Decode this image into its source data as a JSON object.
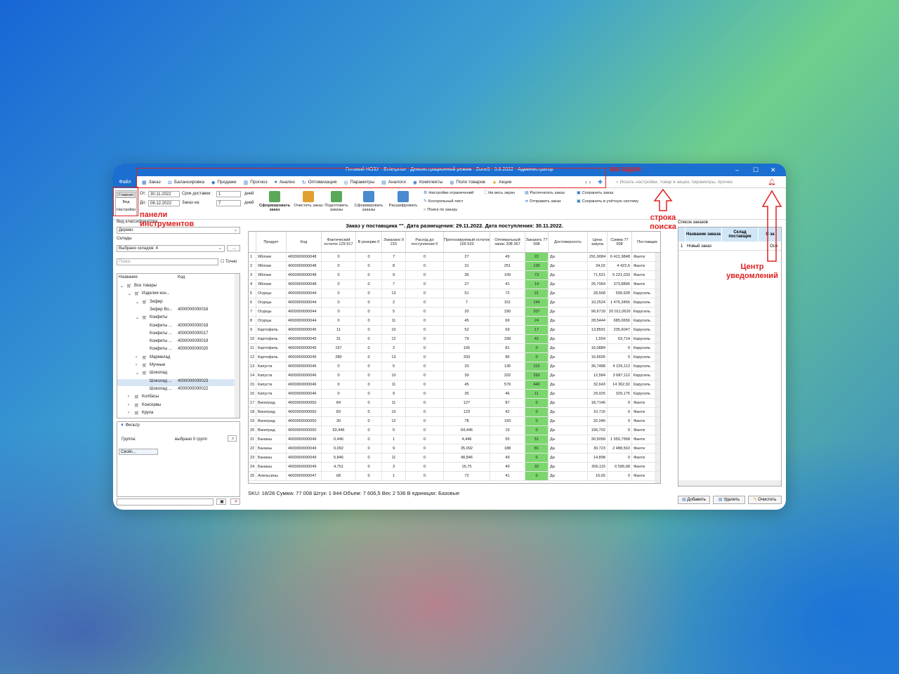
{
  "window": {
    "title": "Готовый НОЗУ · Enterprise · Демонстрационный режим · Zone5 · 5.8.2022 · Администратор",
    "min": "–",
    "max": "☐",
    "close": "✕"
  },
  "file_tab": "Файл",
  "tabs": [
    {
      "label": "Заказ",
      "icon": "order-icon"
    },
    {
      "label": "Балансировка",
      "icon": "balance-icon"
    },
    {
      "label": "Продажи",
      "icon": "sales-icon"
    },
    {
      "label": "Прогноз",
      "icon": "forecast-icon"
    },
    {
      "label": "Анализ",
      "icon": "analysis-icon"
    },
    {
      "label": "Оптимизация",
      "icon": "optimize-icon"
    },
    {
      "label": "Параметры",
      "icon": "params-icon"
    },
    {
      "label": "Аналоги",
      "icon": "analogs-icon"
    },
    {
      "label": "Комплекты",
      "icon": "kits-icon"
    },
    {
      "label": "Поля товаров",
      "icon": "fields-icon"
    },
    {
      "label": "Акции",
      "icon": "star-icon"
    }
  ],
  "search": {
    "placeholder": "Искать настройки, товар в акции, параметры, прочее"
  },
  "view_switch": [
    "Главная",
    "Вид",
    "Настройки"
  ],
  "ribbon": {
    "from_label": "От:",
    "from_value": "30.11.2022",
    "to_label": "До:",
    "to_value": "06.12.2022",
    "delivery_label": "Срок доставки:",
    "delivery_value": "1",
    "order_for_label": "Заказ на:",
    "order_for_value": "7",
    "days1": "дней",
    "days2": "дней",
    "big_buttons": [
      "Сформировать заказ",
      "Очистить заказ",
      "Подготовить заказы",
      "Сформировать заказы",
      "Расшифровать"
    ],
    "small_col1": [
      "Настройки ограничений",
      "Контрольный лист",
      "Поиск по заказу"
    ],
    "fullscreen": "На весь экран",
    "small_col2": [
      "Распечатать заказ",
      "Отправить заказ"
    ],
    "small_col3": [
      "Сохранить заказ",
      "Сохранить в учётную систему"
    ]
  },
  "left": {
    "classifier_label": "Вид классификатора",
    "classifier_value": "Дерево",
    "warehouses_label": "Склады",
    "warehouses_value": "Выбрано складов: 4",
    "dots": "...",
    "search_placeholder": "Поиск",
    "exact_label": "Точно",
    "col_name": "Название",
    "col_code": "Код",
    "tree": [
      {
        "n": "Все товары",
        "c": "",
        "l": 0,
        "e": "⌄"
      },
      {
        "n": "Изделия кон...",
        "c": "",
        "l": 1,
        "e": "⌄"
      },
      {
        "n": "Зефир",
        "c": "",
        "l": 2,
        "e": "⌄"
      },
      {
        "n": "Зефир Во...",
        "c": "4000000000016",
        "l": 3,
        "e": ""
      },
      {
        "n": "Конфеты",
        "c": "",
        "l": 2,
        "e": "⌄"
      },
      {
        "n": "Конфеты ...",
        "c": "4000000000018",
        "l": 3,
        "e": ""
      },
      {
        "n": "Конфеты ...",
        "c": "4000000000017",
        "l": 3,
        "e": ""
      },
      {
        "n": "Конфеты ...",
        "c": "4000000000019",
        "l": 3,
        "e": ""
      },
      {
        "n": "Конфеты ...",
        "c": "4000000000020",
        "l": 3,
        "e": ""
      },
      {
        "n": "Мармелад",
        "c": "",
        "l": 2,
        "e": "›"
      },
      {
        "n": "Мучные",
        "c": "",
        "l": 2,
        "e": "›"
      },
      {
        "n": "Шоколад",
        "c": "",
        "l": 2,
        "e": "⌄"
      },
      {
        "n": "Шоколад ...",
        "c": "4000000000023",
        "l": 3,
        "e": ""
      },
      {
        "n": "Шоколад ...",
        "c": "4000000000022",
        "l": 3,
        "e": ""
      },
      {
        "n": "Колбасы",
        "c": "",
        "l": 1,
        "e": "›"
      },
      {
        "n": "Консервы",
        "c": "",
        "l": 1,
        "e": "›"
      },
      {
        "n": "Крупа",
        "c": "",
        "l": 1,
        "e": "›"
      }
    ],
    "filter_label": "Фильтр",
    "group_label": "Группа:",
    "group_value": "выбрано 0 групп",
    "props": "Свойс..."
  },
  "order": {
    "title": "Заказ у поставщика \"\". Дата размещения: 29.11.2022. Дата поступления: 30.11.2022.",
    "headers": [
      "",
      "Продукт",
      "Код",
      "Фактический остаток 129 917",
      "В резерве 0",
      "Заказано 9 215",
      "Расход до поступления 0",
      "Прогнозируемый остаток 166 533",
      "Оптимальный запас 208 367",
      "Заказать 77 008",
      "Достоверность",
      "Цена закупа",
      "Сумма 77 008",
      "Поставщик"
    ],
    "rows": [
      [
        "1",
        "Яблоки",
        "4000000000048",
        "0",
        "0",
        "7",
        "0",
        "27",
        "49",
        "22",
        "Да",
        "291,9084",
        "6 421,9848",
        "Фанти"
      ],
      [
        "2",
        "Яблоки",
        "4000000000048",
        "0",
        "0",
        "8",
        "0",
        "31",
        "251",
        "130",
        "Да",
        "34,02",
        "4 422,6",
        "Фанти"
      ],
      [
        "3",
        "Яблоки",
        "4000000000048",
        "0",
        "0",
        "9",
        "0",
        "36",
        "109",
        "73",
        "Да",
        "71,521",
        "5 221,033",
        "Фанти"
      ],
      [
        "4",
        "Яблоки",
        "4000000000048",
        "0",
        "0",
        "7",
        "0",
        "27",
        "41",
        "14",
        "Да",
        "26,7064",
        "373,8896",
        "Фанти"
      ],
      [
        "5",
        "Огурцы",
        "4000000000044",
        "0",
        "0",
        "13",
        "0",
        "51",
        "72",
        "21",
        "Да",
        "28,568",
        "599,928",
        "Карусель"
      ],
      [
        "6",
        "Огурцы",
        "4000000000044",
        "0",
        "0",
        "2",
        "0",
        "7",
        "151",
        "144",
        "Да",
        "10,2524",
        "1 476,3456",
        "Карусель"
      ],
      [
        "7",
        "Огурцы",
        "4000000000044",
        "0",
        "0",
        "5",
        "0",
        "20",
        "330",
        "207",
        "Да",
        "96,6718",
        "20 011,0626",
        "Карусель"
      ],
      [
        "8",
        "Огурцы",
        "4000000000044",
        "0",
        "0",
        "11",
        "0",
        "45",
        "69",
        "24",
        "Да",
        "28,5444",
        "685,0656",
        "Карусель"
      ],
      [
        "9",
        "Картофель",
        "4000000000045",
        "11",
        "0",
        "10",
        "0",
        "52",
        "69",
        "17",
        "Да",
        "13,8591",
        "235,6047",
        "Карусель"
      ],
      [
        "10",
        "Картофель",
        "4000000000045",
        "31",
        "0",
        "12",
        "0",
        "79",
        "338",
        "41",
        "Да",
        "1,554",
        "63,714",
        "Карусель"
      ],
      [
        "11",
        "Картофель",
        "4000000000045",
        "157",
        "0",
        "2",
        "0",
        "165",
        "81",
        "0",
        "Да",
        "16,0884",
        "0",
        "Карусель"
      ],
      [
        "12",
        "Картофель",
        "4000000000045",
        "280",
        "0",
        "13",
        "0",
        "333",
        "86",
        "0",
        "Да",
        "16,6605",
        "0",
        "Карусель"
      ],
      [
        "13",
        "Капуста",
        "4000000000046",
        "0",
        "0",
        "5",
        "0",
        "20",
        "135",
        "115",
        "Да",
        "36,7488",
        "4 226,112",
        "Карусель"
      ],
      [
        "14",
        "Капуста",
        "4000000000046",
        "0",
        "0",
        "10",
        "0",
        "39",
        "332",
        "293",
        "Да",
        "12,584",
        "3 687,112",
        "Карусель"
      ],
      [
        "15",
        "Капуста",
        "4000000000046",
        "0",
        "0",
        "11",
        "0",
        "45",
        "579",
        "440",
        "Да",
        "32,643",
        "14 362,92",
        "Карусель"
      ],
      [
        "16",
        "Капуста",
        "4000000000046",
        "0",
        "0",
        "9",
        "0",
        "35",
        "46",
        "11",
        "Да",
        "29,925",
        "329,175",
        "Карусель"
      ],
      [
        "17",
        "Виноград",
        "4000000000050",
        "84",
        "0",
        "11",
        "0",
        "127",
        "87",
        "0",
        "Да",
        "18,7146",
        "0",
        "Фанти"
      ],
      [
        "18",
        "Виноград",
        "4000000000050",
        "83",
        "0",
        "10",
        "0",
        "123",
        "42",
        "0",
        "Да",
        "10,716",
        "0",
        "Фанти"
      ],
      [
        "19",
        "Виноград",
        "4000000000050",
        "30",
        "0",
        "12",
        "0",
        "78",
        "193",
        "0",
        "Да",
        "32,046",
        "0",
        "Фанти"
      ],
      [
        "20",
        "Виноград",
        "4000000000050",
        "63,446",
        "0",
        "0",
        "0",
        "64,446",
        "19",
        "0",
        "Да",
        "156,702",
        "0",
        "Фанти"
      ],
      [
        "21",
        "Бананы",
        "4000000000049",
        "0,446",
        "0",
        "1",
        "0",
        "4,446",
        "55",
        "51",
        "Да",
        "30,5058",
        "1 555,7958",
        "Фанти"
      ],
      [
        "22",
        "Бананы",
        "4000000000049",
        "0,092",
        "0",
        "9",
        "0",
        "35,092",
        "188",
        "81",
        "Да",
        "30,723",
        "2 488,563",
        "Фанти"
      ],
      [
        "23",
        "Бананы",
        "4000000000049",
        "5,846",
        "0",
        "11",
        "0",
        "48,846",
        "49",
        "0",
        "Да",
        "14,898",
        "0",
        "Фанти"
      ],
      [
        "24",
        "Бананы",
        "4000000000049",
        "4,751",
        "0",
        "3",
        "0",
        "16,75",
        "49",
        "32",
        "Да",
        "206,115",
        "6 595,68",
        "Фанти"
      ],
      [
        "25",
        "Апельсины",
        "4000000000047",
        "68",
        "0",
        "1",
        "0",
        "72",
        "41",
        "0",
        "Да",
        "16,65",
        "0",
        "Фанти"
      ]
    ],
    "status": "SKU: 18/28  Сумма: 77 008  Штук: 1 844  Объем: 7 606,5  Вес 2 536  В единицах: Базовые"
  },
  "right": {
    "list_label": "Список заказов",
    "headers": [
      "Название заказа",
      "Склад поставщик",
      "С за"
    ],
    "row_num": "1",
    "row_name": "Новый заказ",
    "row_extra": "Осн",
    "add": "Добавить",
    "del": "Удалить",
    "clear": "Очистить"
  },
  "annotations": {
    "tabs": "вкладки",
    "toolbars": "панели инструментов",
    "search": "строка поиска",
    "notifications": "Центр уведомлений"
  },
  "colors": {
    "accent": "#1a6fd0",
    "annotation": "#e02020",
    "highlight": "#7cd66e"
  }
}
